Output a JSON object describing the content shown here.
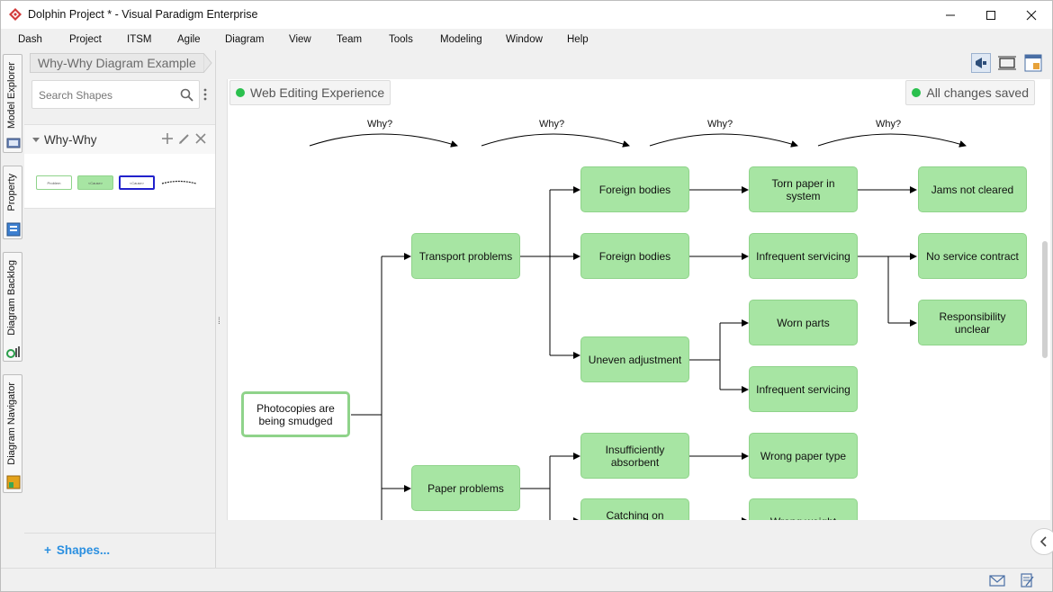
{
  "window": {
    "title": "Dolphin Project * - Visual Paradigm Enterprise",
    "controls": {
      "minimize": "—",
      "maximize": "☐",
      "close": "✕"
    }
  },
  "menu": [
    "Dash",
    "Project",
    "ITSM",
    "Agile",
    "Diagram",
    "View",
    "Team",
    "Tools",
    "Modeling",
    "Window",
    "Help"
  ],
  "vertical_tabs": [
    "Model Explorer",
    "Property",
    "Diagram Backlog",
    "Diagram Navigator"
  ],
  "breadcrumb": "Why-Why Diagram Example",
  "left_panel": {
    "search_placeholder": "Search Shapes",
    "stencil_name": "Why-Why",
    "shapes_link": "Shapes...",
    "shape_items": [
      "Problem",
      "<Cause>",
      "<Cause>"
    ]
  },
  "canvas": {
    "mode_label": "Web Editing Experience",
    "save_status": "All changes saved",
    "why_labels": [
      "Why?",
      "Why?",
      "Why?",
      "Why?"
    ],
    "nodes": {
      "root": "Photocopies are being smudged",
      "transport": "Transport problems",
      "paper": "Paper problems",
      "foreign1": "Foreign bodies",
      "foreign2": "Foreign bodies",
      "uneven": "Uneven adjustment",
      "insufficient": "Insufficiently absorbent",
      "catching": "Catching on transport",
      "torn": "Torn paper in system",
      "infrequent1": "Infrequent servicing",
      "worn": "Worn parts",
      "infrequent2": "Infrequent servicing",
      "wrongtype": "Wrong paper type",
      "wrongweight": "Wrong weight",
      "jams": "Jams not cleared",
      "nocontract": "No service contract",
      "responsibility": "Responsibility unclear"
    }
  },
  "colors": {
    "node_fill": "#a7e5a3",
    "node_border": "#8fd38a",
    "status_dot": "#2bc04e",
    "link": "#2a8fe0"
  }
}
